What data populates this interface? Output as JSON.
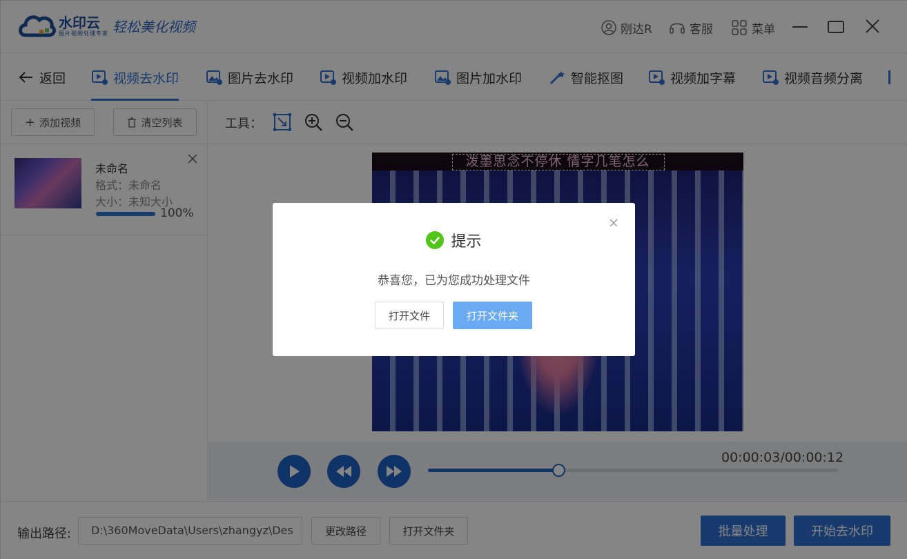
{
  "app": {
    "brand": "水印云",
    "brand_sub": "图片视频处理专家",
    "slogan": "轻松美化视频"
  },
  "titlebar": {
    "user_label": "刚达R",
    "support_label": "客服",
    "menu_label": "菜单"
  },
  "nav": {
    "back_label": "返回",
    "items": [
      {
        "label": "视频去水印",
        "active": true
      },
      {
        "label": "图片去水印"
      },
      {
        "label": "视频加水印"
      },
      {
        "label": "图片加水印"
      },
      {
        "label": "智能抠图"
      },
      {
        "label": "视频加字幕"
      },
      {
        "label": "视频音频分离"
      }
    ]
  },
  "sidebar": {
    "add_label": "添加视频",
    "clear_label": "清空列表",
    "file": {
      "name": "未命名",
      "format": "格式：未命名",
      "size": "大小：未知大小",
      "progress": 1.0,
      "progress_label": "100%"
    }
  },
  "toolbar": {
    "label": "工具："
  },
  "preview": {
    "subtitle": "泼墨思念不停休 情字几笔怎么"
  },
  "player": {
    "time": "00:00:03/00:00:12",
    "progress": 0.32
  },
  "bottom": {
    "output_label": "输出路径:",
    "output_path": "D:\\360MoveData\\Users\\zhangyz\\Des",
    "change_path_label": "更改路径",
    "open_folder_label": "打开文件夹",
    "batch_label": "批量处理",
    "start_label": "开始去水印"
  },
  "dialog": {
    "title": "提示",
    "message": "恭喜您，已为您成功处理文件",
    "open_file_label": "打开文件",
    "open_folder_label": "打开文件夹"
  },
  "colors": {
    "accent": "#2e6fd0",
    "player_blue": "#1f63c6",
    "success": "#52c41a",
    "dialog_primary": "#6aaaf5"
  }
}
